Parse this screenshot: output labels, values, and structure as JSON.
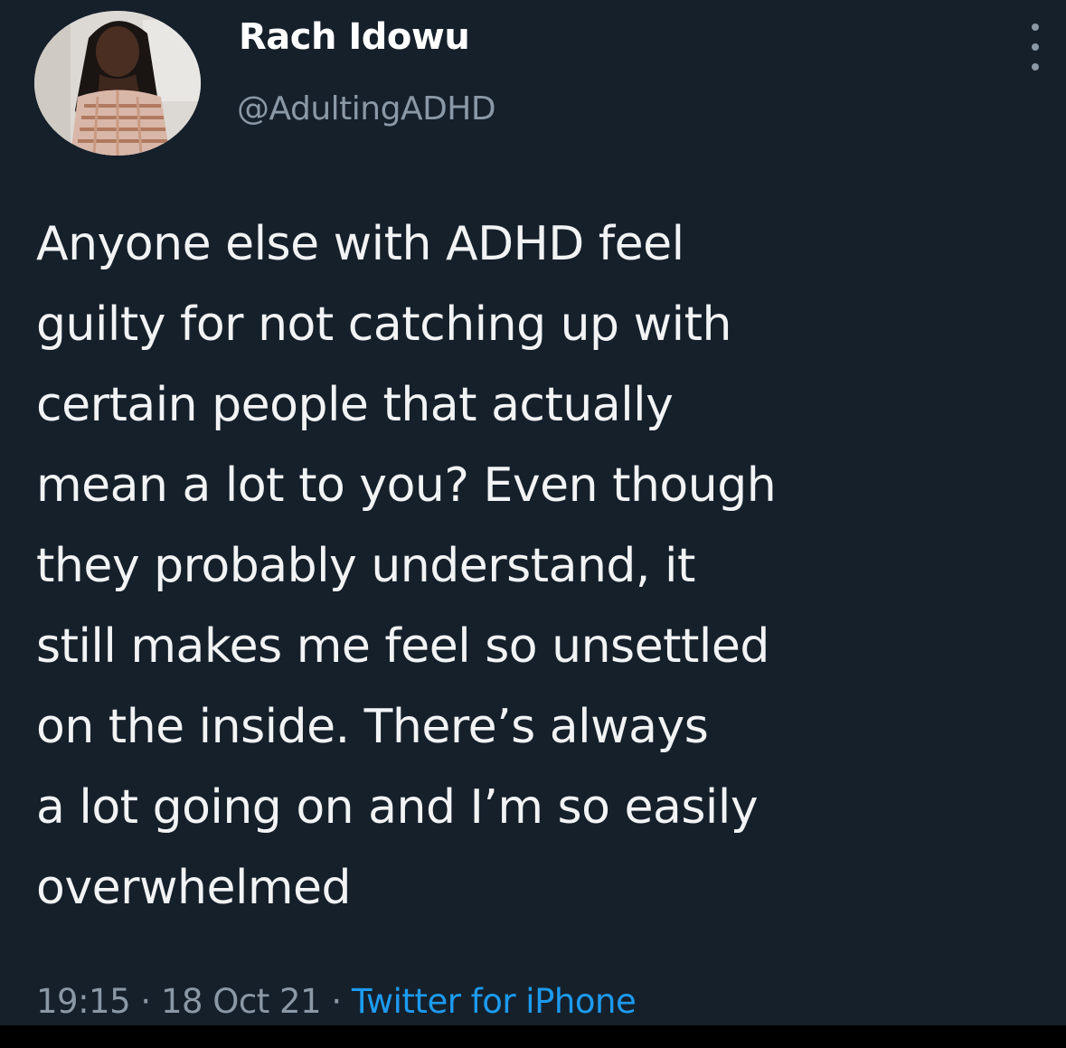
{
  "author": {
    "display_name": "Rach Idowu",
    "handle": "@AdultingADHD"
  },
  "tweet": {
    "lines": [
      "Anyone else with ADHD feel",
      "guilty for not catching up with",
      "certain people that actually",
      "mean a lot to you? Even though",
      "they probably understand, it",
      "still makes me feel so unsettled",
      "on the inside. There’s always",
      "a lot going on and I’m so easily",
      "overwhelmed"
    ],
    "time": "19:15",
    "separator": "·",
    "date": "18 Oct 21",
    "source": "Twitter for iPhone"
  },
  "icons": {
    "avatar": "profile-photo",
    "more": "more-vertical-icon"
  },
  "colors": {
    "background": "#15202b",
    "text": "#f2f3f4",
    "secondary": "#8b98a5",
    "link": "#1d9bf0"
  }
}
